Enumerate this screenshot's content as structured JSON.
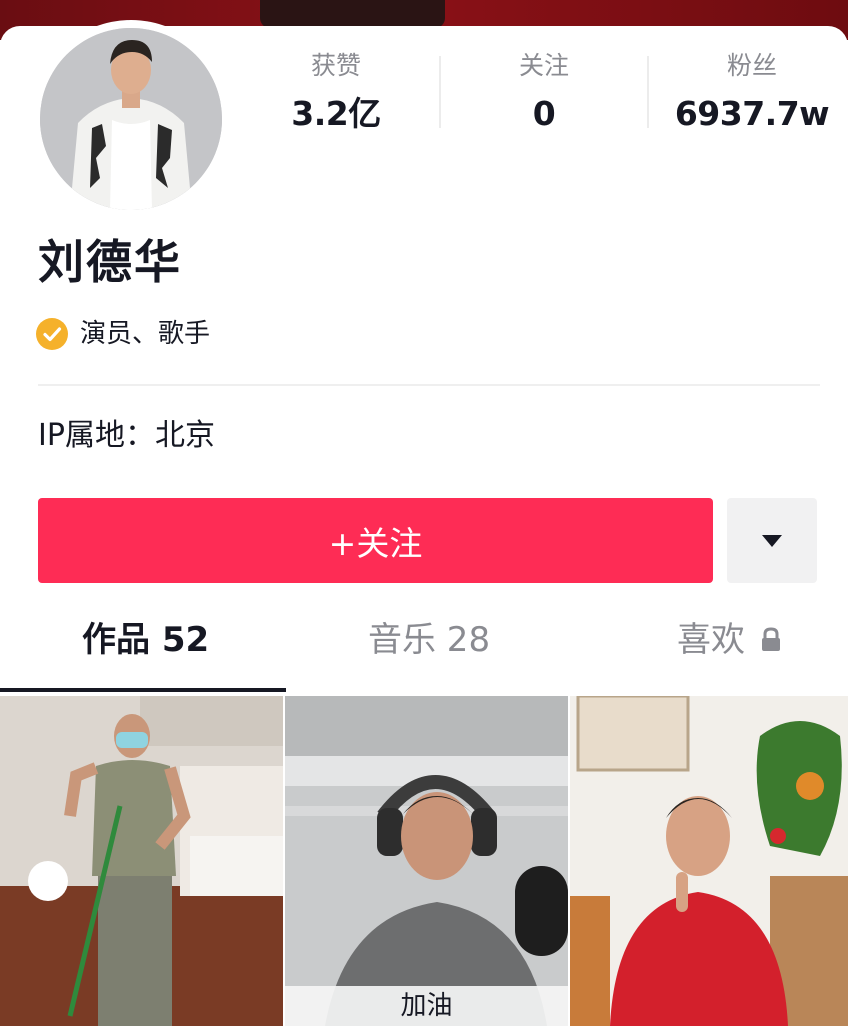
{
  "profile": {
    "name": "刘德华",
    "verified_label": "演员、歌手",
    "ip_location": "IP属地：北京"
  },
  "stats": [
    {
      "label": "获赞",
      "value": "3.2亿"
    },
    {
      "label": "关注",
      "value": "0"
    },
    {
      "label": "粉丝",
      "value": "6937.7w"
    }
  ],
  "actions": {
    "follow_label": "+关注"
  },
  "tabs": [
    {
      "label": "作品 52",
      "active": true
    },
    {
      "label": "音乐 28",
      "active": false
    },
    {
      "label": "喜欢",
      "active": false,
      "locked": true
    }
  ],
  "videos": [
    {
      "caption": ""
    },
    {
      "caption": "加油"
    },
    {
      "caption": ""
    }
  ],
  "colors": {
    "accent": "#fe2c55",
    "verified": "#f5b12b",
    "muted_text": "#8a8b91"
  }
}
